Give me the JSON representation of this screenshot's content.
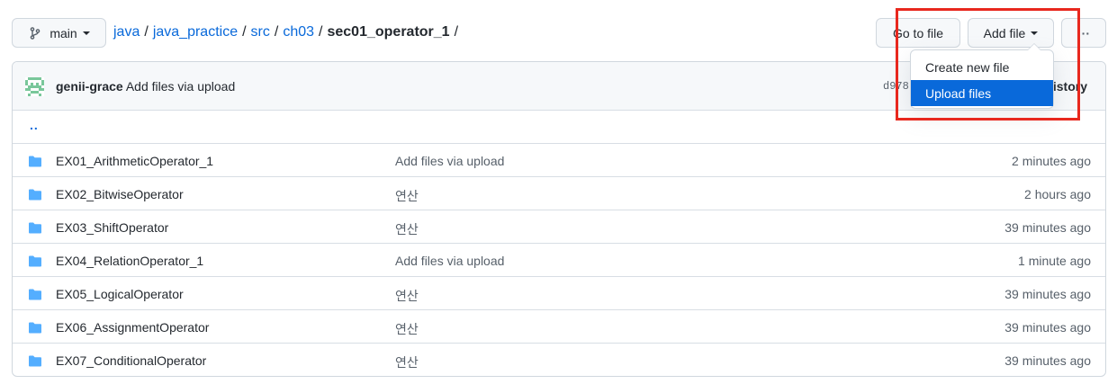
{
  "branch": {
    "label": "main",
    "icon": "git-branch-icon"
  },
  "breadcrumb": {
    "parts": [
      "java",
      "java_practice",
      "src",
      "ch03"
    ],
    "current": "sec01_operator_1",
    "separator": "/"
  },
  "buttons": {
    "go_to_file": "Go to file",
    "add_file": "Add file",
    "more": "···"
  },
  "menu": {
    "items": [
      "Create new file",
      "Upload files"
    ],
    "active_index": 1
  },
  "commit": {
    "author": "genii-grace",
    "message": "Add files via upload",
    "sha": "d978",
    "history": "istory"
  },
  "parent_dir": "..",
  "files": [
    {
      "name": "EX01_ArithmeticOperator_1",
      "message": "Add files via upload",
      "age": "2 minutes ago"
    },
    {
      "name": "EX02_BitwiseOperator",
      "message": "연산",
      "age": "2 hours ago"
    },
    {
      "name": "EX03_ShiftOperator",
      "message": "연산",
      "age": "39 minutes ago"
    },
    {
      "name": "EX04_RelationOperator_1",
      "message": "Add files via upload",
      "age": "1 minute ago"
    },
    {
      "name": "EX05_LogicalOperator",
      "message": "연산",
      "age": "39 minutes ago"
    },
    {
      "name": "EX06_AssignmentOperator",
      "message": "연산",
      "age": "39 minutes ago"
    },
    {
      "name": "EX07_ConditionalOperator",
      "message": "연산",
      "age": "39 minutes ago"
    }
  ],
  "colors": {
    "link": "#0969da",
    "folder": "#54aeff",
    "highlight_box": "#e8281e",
    "menu_active": "#0969da"
  }
}
